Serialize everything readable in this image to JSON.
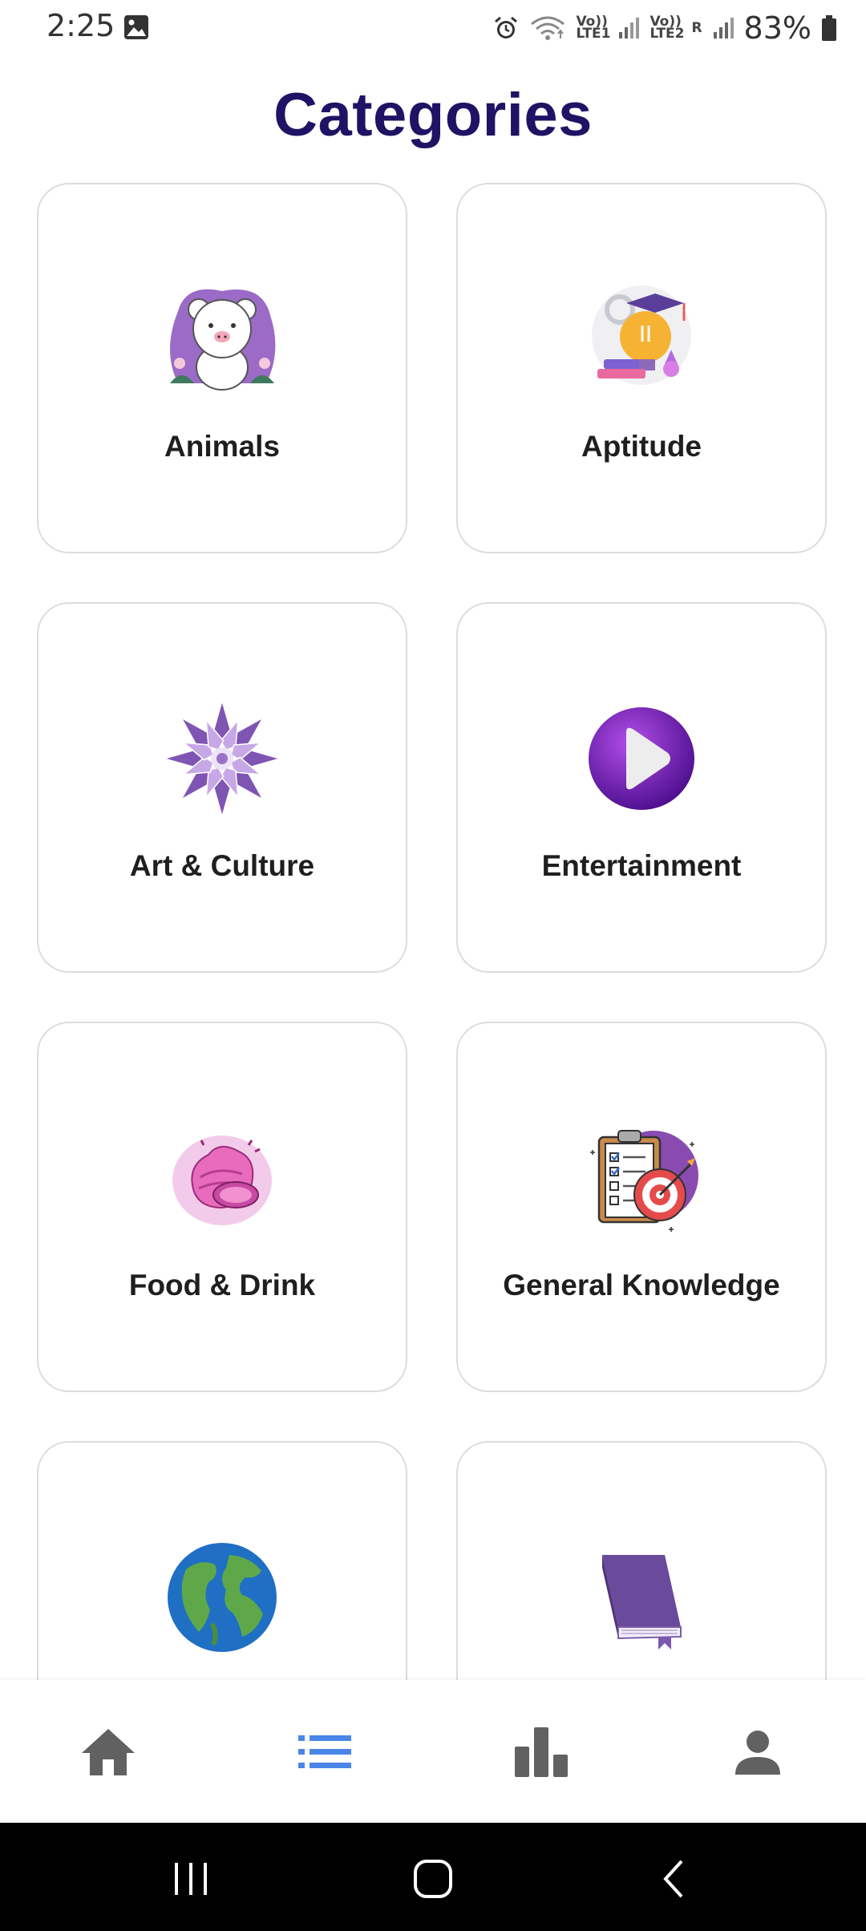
{
  "status_bar": {
    "time": "2:25",
    "sim1_label": "Vo)) LTE1",
    "sim2_label": "Vo)) LTE2",
    "roaming": "R",
    "battery": "83%",
    "icons": [
      "image-icon",
      "alarm-icon",
      "wifi-icon",
      "signal-icon",
      "signal-icon",
      "battery-icon"
    ]
  },
  "page": {
    "title": "Categories"
  },
  "categories": [
    {
      "label": "Animals",
      "icon": "bear-icon"
    },
    {
      "label": "Aptitude",
      "icon": "lightbulb-graduation-icon"
    },
    {
      "label": "Art & Culture",
      "icon": "lotus-icon"
    },
    {
      "label": "Entertainment",
      "icon": "play-icon"
    },
    {
      "label": "Food & Drink",
      "icon": "cupcake-icon"
    },
    {
      "label": "General Knowledge",
      "icon": "clipboard-target-icon"
    },
    {
      "label": "",
      "icon": "globe-icon"
    },
    {
      "label": "",
      "icon": "book-icon"
    }
  ],
  "bottom_nav": {
    "items": [
      {
        "name": "home",
        "icon": "home-icon",
        "active": false
      },
      {
        "name": "categories",
        "icon": "list-icon",
        "active": true
      },
      {
        "name": "leaderboard",
        "icon": "bar-chart-icon",
        "active": false
      },
      {
        "name": "profile",
        "icon": "person-icon",
        "active": false
      }
    ],
    "active_color": "#4a86e8",
    "inactive_color": "#616161"
  },
  "system_nav": {
    "items": [
      "recents-icon",
      "home-circle-icon",
      "back-icon"
    ]
  },
  "colors": {
    "title": "#1e1364",
    "card_border": "#dcdcdc",
    "accent": "#4a86e8"
  }
}
